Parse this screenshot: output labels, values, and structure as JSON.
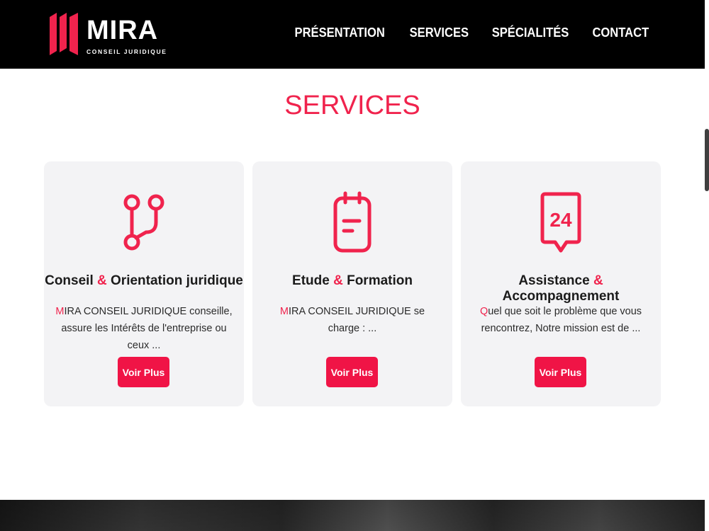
{
  "header": {
    "logo": {
      "name": "MIRA",
      "subtitle": "CONSEIL JURIDIQUE"
    },
    "nav": [
      {
        "label": "PRÉSENTATION"
      },
      {
        "label": "SERVICES"
      },
      {
        "label": "SPÉCIALITÉS"
      },
      {
        "label": "CONTACT"
      }
    ]
  },
  "colors": {
    "accent": "#f0234d",
    "header_bg": "#000000",
    "card_bg": "#f3f3f5",
    "button_bg": "#f01446"
  },
  "section": {
    "title": "SERVICES"
  },
  "cards": [
    {
      "icon": "branch-icon",
      "title_part1": "Conseil",
      "title_amp": "&",
      "title_part2": "Orientation juridique",
      "desc_first": "M",
      "desc_rest": "IRA CONSEIL JURIDIQUE conseille, assure les Intérêts de l'entreprise ou ceux ...",
      "button": "Voir Plus"
    },
    {
      "icon": "clipboard-icon",
      "title_part1": "Etude",
      "title_amp": "&",
      "title_part2": "Formation",
      "desc_first": "M",
      "desc_rest": "IRA CONSEIL JURIDIQUE se charge : ...",
      "button": "Voir Plus"
    },
    {
      "icon": "support-24-icon",
      "icon_text": "24",
      "title_part1": "Assistance",
      "title_amp": "&",
      "title_part2": "Accompagnement",
      "desc_first": "Q",
      "desc_rest": "uel que soit le problème que vous rencontrez, Notre mission est de ...",
      "button": "Voir Plus"
    }
  ]
}
